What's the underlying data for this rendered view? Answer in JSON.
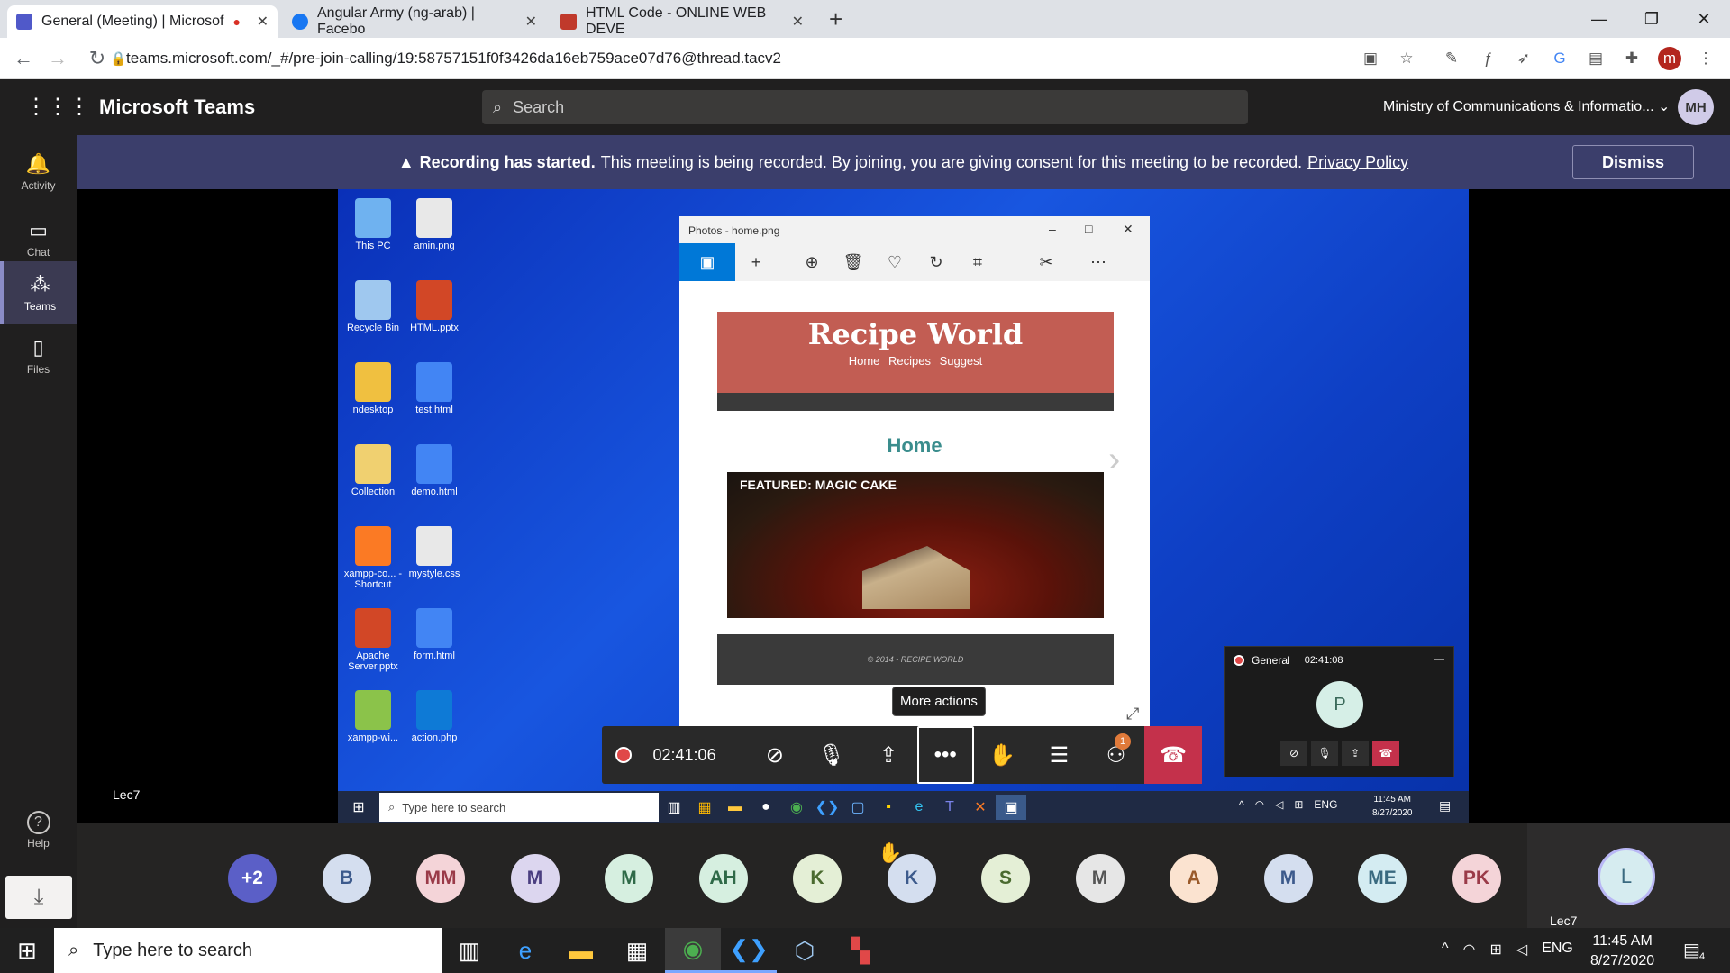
{
  "browser": {
    "tabs": [
      {
        "title": "General (Meeting) | Microsof",
        "color": "#5059c9"
      },
      {
        "title": "Angular Army (ng-arab) | Facebo",
        "color": "#1877f2"
      },
      {
        "title": "HTML Code - ONLINE WEB DEVE",
        "color": "#c0392b"
      }
    ],
    "new_tab": "+",
    "url": "teams.microsoft.com/_#/pre-join-calling/19:58757151f0f3426da16eb759ace07d76@thread.tacv2",
    "profile_initial": "m"
  },
  "teams": {
    "app_title": "Microsoft Teams",
    "search_placeholder": "Search",
    "org": "Ministry of Communications & Informatio...",
    "user_initials": "MH",
    "rail": [
      {
        "label": "Activity",
        "icon": "bell-icon"
      },
      {
        "label": "Chat",
        "icon": "chat-icon"
      },
      {
        "label": "Teams",
        "icon": "teams-icon"
      },
      {
        "label": "Files",
        "icon": "files-icon"
      }
    ],
    "help_label": "Help",
    "banner": {
      "bold": "Recording has started.",
      "text": "This meeting is being recorded. By joining, you are giving consent for this meeting to be recorded.",
      "link": "Privacy Policy",
      "dismiss": "Dismiss"
    }
  },
  "desktop_icons": [
    {
      "label": "This PC",
      "color": "#6fb2f0"
    },
    {
      "label": "amin.png",
      "color": "#e8e8e8"
    },
    {
      "label": "Recycle Bin",
      "color": "#9fc8ef"
    },
    {
      "label": "HTML.pptx",
      "color": "#d24726"
    },
    {
      "label": "ndesktop",
      "color": "#f0c040"
    },
    {
      "label": "test.html",
      "color": "#4285f4"
    },
    {
      "label": "Collection",
      "color": "#f0d070"
    },
    {
      "label": "demo.html",
      "color": "#4285f4"
    },
    {
      "label": "xampp-co... - Shortcut",
      "color": "#fb7a24"
    },
    {
      "label": "mystyle.css",
      "color": "#e8e8e8"
    },
    {
      "label": "Apache Server.pptx",
      "color": "#d24726"
    },
    {
      "label": "form.html",
      "color": "#4285f4"
    },
    {
      "label": "xampp-wi...",
      "color": "#8bc34a"
    },
    {
      "label": "action.php",
      "color": "#0e7ad6"
    }
  ],
  "photos": {
    "title": "Photos - home.png",
    "recipe_title": "Recipe World",
    "recipe_nav": "Home Recipes Suggest",
    "home_heading": "Home",
    "featured": "FEATURED: MAGIC CAKE",
    "footer": "© 2014 - RECIPE WORLD"
  },
  "meeting": {
    "timer": "02:41:06",
    "tooltip": "More actions",
    "badge": "1",
    "mini_title": "General",
    "mini_timer": "02:41:08",
    "mini_avatar": "P",
    "presenter_label": "Lec7"
  },
  "remote_taskbar": {
    "search": "Type here to search",
    "lang": "ENG",
    "time": "11:45 AM",
    "date": "8/27/2020"
  },
  "participants": [
    {
      "initials": "+2",
      "bg": "#5b5fc7",
      "fg": "#fff"
    },
    {
      "initials": "B",
      "bg": "#d4deef",
      "fg": "#3c5a8c"
    },
    {
      "initials": "MM",
      "bg": "#f4d4d8",
      "fg": "#9a3a48"
    },
    {
      "initials": "M",
      "bg": "#dcd6ef",
      "fg": "#4a3e80"
    },
    {
      "initials": "M",
      "bg": "#d6efe0",
      "fg": "#2f6a48"
    },
    {
      "initials": "AH",
      "bg": "#d6efe0",
      "fg": "#2f6a48"
    },
    {
      "initials": "K",
      "bg": "#e4efd6",
      "fg": "#4a6a2f"
    },
    {
      "initials": "K",
      "bg": "#d4deef",
      "fg": "#3c5a8c"
    },
    {
      "initials": "S",
      "bg": "#e4efd6",
      "fg": "#4a6a2f"
    },
    {
      "initials": "M",
      "bg": "#e6e6e6",
      "fg": "#555"
    },
    {
      "initials": "A",
      "bg": "#fbe3d0",
      "fg": "#9a5a2a"
    },
    {
      "initials": "M",
      "bg": "#d4deef",
      "fg": "#3c5a8c"
    },
    {
      "initials": "ME",
      "bg": "#d4ecf2",
      "fg": "#3a6a80"
    },
    {
      "initials": "PK",
      "bg": "#f4d4d8",
      "fg": "#9a3a48"
    }
  ],
  "self": {
    "initials": "L",
    "label": "Lec7"
  },
  "host_taskbar": {
    "search": "Type here to search",
    "lang": "ENG",
    "time": "11:45 AM",
    "date": "8/27/2020",
    "notif_count": "4"
  }
}
